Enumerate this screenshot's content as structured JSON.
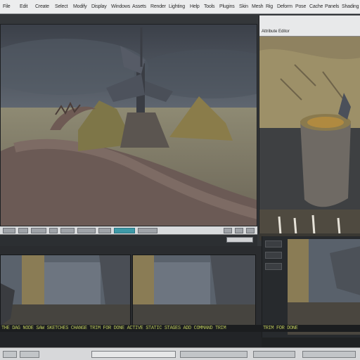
{
  "menubar": {
    "items": [
      "File",
      "Edit",
      "Create",
      "Select",
      "Modify",
      "Display",
      "Windows",
      "Assets",
      "Render",
      "Lighting",
      "Help",
      "Tools",
      "Plugins",
      "Skin",
      "Mesh",
      "Rig",
      "Deform",
      "Pose",
      "Cache",
      "Panels",
      "Shading"
    ]
  },
  "rpanel": {
    "title": "Attribute Editor"
  },
  "status": {
    "line": "THE DAG NODE SAW SKETCHES CHANGE TRIM FOR DONE ACTIVE STATIC STAGES ADD COMMAND TRIM",
    "line_right": "TRIM FOR DONE"
  },
  "colors": {
    "accent": "#3e9aa8",
    "status_text": "#b8c45a"
  }
}
